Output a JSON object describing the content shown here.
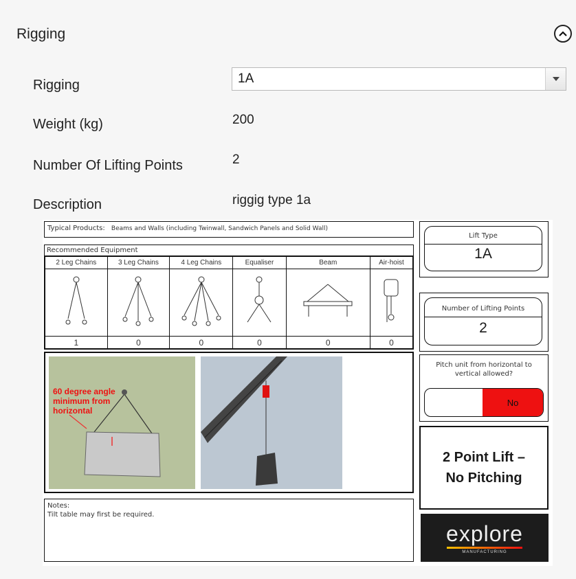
{
  "section": {
    "title": "Rigging"
  },
  "fields": {
    "rigging_label": "Rigging",
    "rigging_value": "1A",
    "weight_label": "Weight (kg)",
    "weight_value": "200",
    "lifting_points_label": "Number Of Lifting Points",
    "lifting_points_value": "2",
    "description_label": "Description",
    "description_value": "riggig type 1a"
  },
  "card": {
    "typical_products_label": "Typical Products:",
    "typical_products_value": "Beams and Walls (including Twinwall, Sandwich Panels and Solid Wall)",
    "recommended_equipment": "Recommended Equipment",
    "equipment": [
      {
        "name": "2 Leg Chains",
        "qty": "1"
      },
      {
        "name": "3 Leg Chains",
        "qty": "0"
      },
      {
        "name": "4 Leg Chains",
        "qty": "0"
      },
      {
        "name": "Equaliser",
        "qty": "0"
      },
      {
        "name": "Beam",
        "qty": "0"
      },
      {
        "name": "Air-hoist",
        "qty": "0"
      }
    ],
    "diagram_annotation": [
      "60 degree angle",
      "minimum from",
      "horizontal"
    ],
    "notes_label": "Notes:",
    "notes_text": "Tilt table may first be required.",
    "lift_type_label": "Lift Type",
    "lift_type_value": "1A",
    "lifting_points_label": "Number of Lifting Points",
    "lifting_points_value": "2",
    "pitch_question": "Pitch unit from horizontal to vertical allowed?",
    "pitch_no": "No",
    "summary_line1": "2 Point Lift –",
    "summary_line2": "No Pitching",
    "logo_text": "explore",
    "logo_sub": "MANUFACTURING"
  },
  "colors": {
    "accent_red": "#ee1111",
    "logo_bg": "#1c1c1c",
    "photo_green": "#b7c29d",
    "sky": "#bcc7d2"
  }
}
